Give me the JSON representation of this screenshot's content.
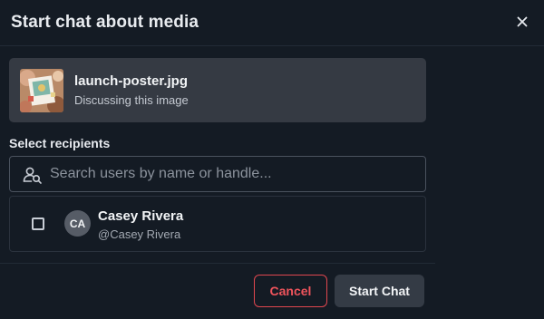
{
  "dialog": {
    "title": "Start chat about media"
  },
  "media": {
    "filename": "launch-poster.jpg",
    "subtitle": "Discussing this image"
  },
  "recipients": {
    "label": "Select recipients",
    "search_placeholder": "Search users by name or handle...",
    "search_value": "",
    "users": [
      {
        "initials": "CA",
        "name": "Casey Rivera",
        "handle": "@Casey Rivera",
        "selected": false
      }
    ]
  },
  "footer": {
    "cancel_label": "Cancel",
    "start_label": "Start Chat"
  },
  "colors": {
    "background": "#141b24",
    "card": "#353a43",
    "cancel_accent": "#e0474f",
    "primary_button": "#343b45",
    "avatar": "#565c66"
  },
  "icons": {
    "close": "close-icon",
    "search": "user-search-icon",
    "thumbnail": "image-thumbnail"
  }
}
